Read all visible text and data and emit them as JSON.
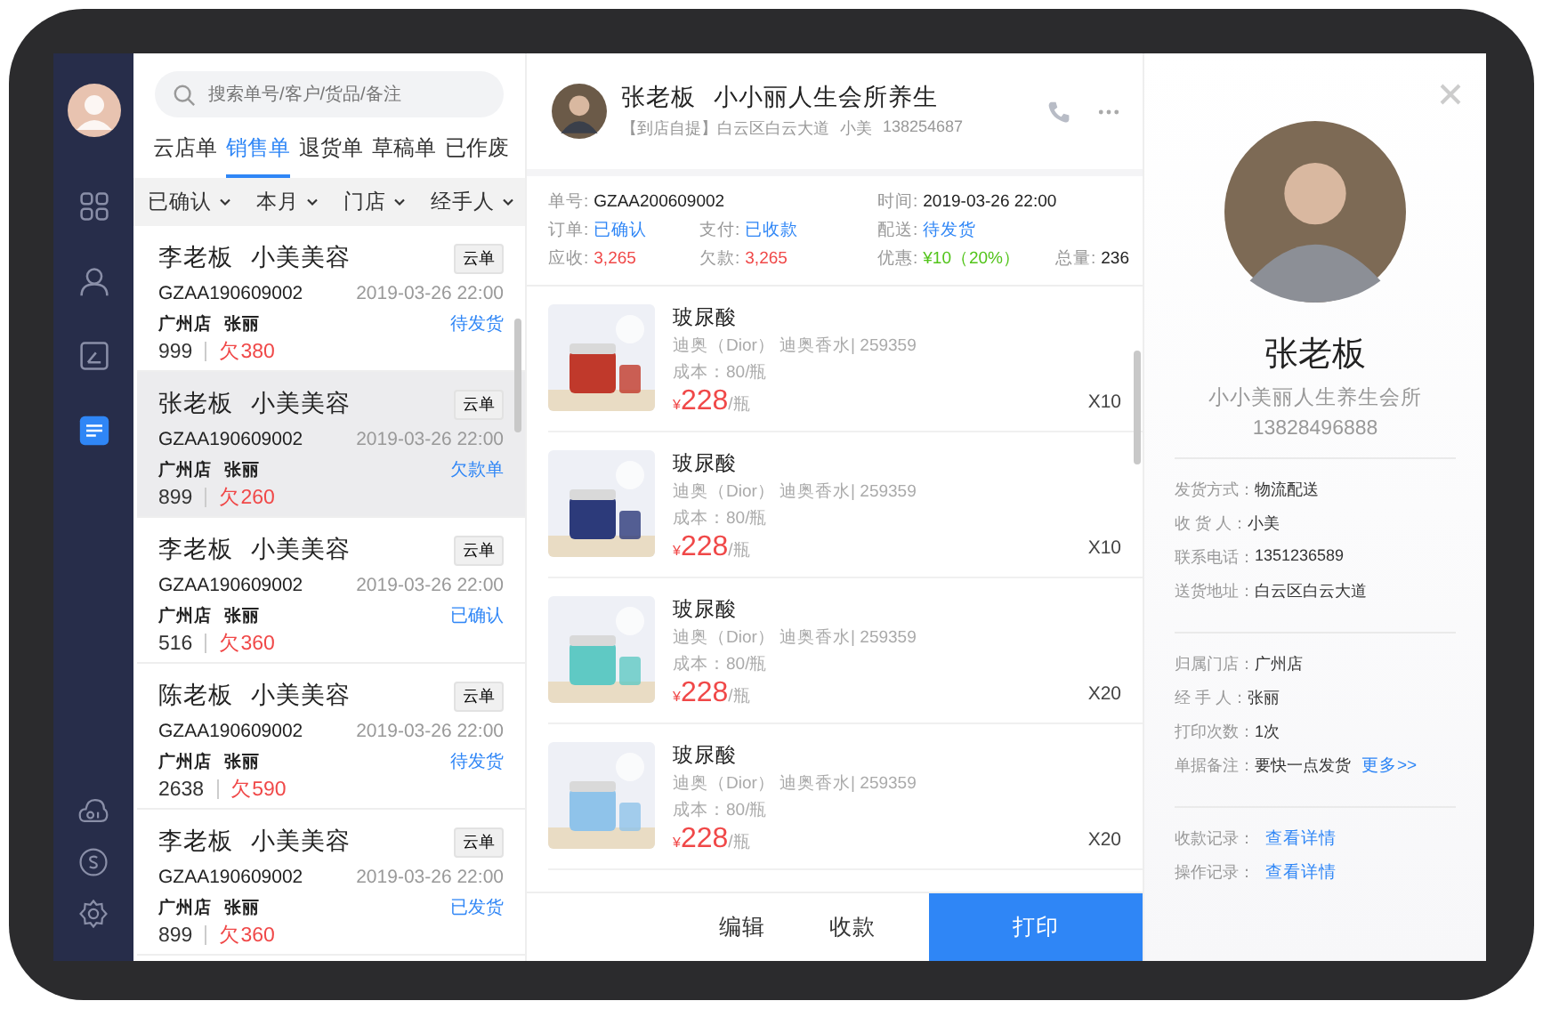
{
  "sidebar": {
    "nav": [
      {
        "kind": "grid",
        "selected": false
      },
      {
        "kind": "user",
        "selected": false
      },
      {
        "kind": "report",
        "selected": false
      },
      {
        "kind": "orders",
        "selected": true
      }
    ],
    "bottom": [
      {
        "kind": "ai"
      },
      {
        "kind": "coin"
      },
      {
        "kind": "gear"
      }
    ]
  },
  "order_list": {
    "search": {
      "placeholder": "搜索单号/客户/货品/备注"
    },
    "tabs": [
      {
        "label": "云店单",
        "selected": false
      },
      {
        "label": "销售单",
        "selected": true
      },
      {
        "label": "退货单",
        "selected": false
      },
      {
        "label": "草稿单",
        "selected": false
      },
      {
        "label": "已作废",
        "selected": false
      }
    ],
    "filters": [
      "已确认",
      "本月",
      "门店",
      "经手人"
    ],
    "orders": [
      {
        "customer": "李老板",
        "shop": "小美美容",
        "tag": "云单",
        "code": "GZAA190609002",
        "time": "2019-03-26 22:00",
        "store": "广州店",
        "handler": "张丽",
        "amount": "999",
        "debt": "欠380",
        "status": "待发货",
        "selected": false
      },
      {
        "customer": "张老板",
        "shop": "小美美容",
        "tag": "云单",
        "code": "GZAA190609002",
        "time": "2019-03-26 22:00",
        "store": "广州店",
        "handler": "张丽",
        "amount": "899",
        "debt": "欠260",
        "status": "欠款单",
        "selected": true
      },
      {
        "customer": "李老板",
        "shop": "小美美容",
        "tag": "云单",
        "code": "GZAA190609002",
        "time": "2019-03-26 22:00",
        "store": "广州店",
        "handler": "张丽",
        "amount": "516",
        "debt": "欠360",
        "status": "已确认",
        "selected": false
      },
      {
        "customer": "陈老板",
        "shop": "小美美容",
        "tag": "云单",
        "code": "GZAA190609002",
        "time": "2019-03-26 22:00",
        "store": "广州店",
        "handler": "张丽",
        "amount": "2638",
        "debt": "欠590",
        "status": "待发货",
        "selected": false
      },
      {
        "customer": "李老板",
        "shop": "小美美容",
        "tag": "云单",
        "code": "GZAA190609002",
        "time": "2019-03-26 22:00",
        "store": "广州店",
        "handler": "张丽",
        "amount": "899",
        "debt": "欠360",
        "status": "已发货",
        "selected": false
      }
    ]
  },
  "order_detail": {
    "customer": "张老板",
    "shop": "小小丽人生会所养生",
    "pickup": "【到店自提】白云区白云大道",
    "contact": "小美",
    "phone": "138254687",
    "fields": [
      {
        "label": "单号:",
        "value": "GZAA200609002",
        "kind": "plain"
      },
      {
        "label": "时间:",
        "value": "2019-03-26 22:00",
        "kind": "plain"
      },
      {
        "label": "订单:",
        "value": "已确认",
        "kind": "status"
      },
      {
        "label": "支付:",
        "value": "已收款",
        "kind": "status"
      },
      {
        "label": "配送:",
        "value": "待发货",
        "kind": "status"
      },
      {
        "label": "应收:",
        "value": "3,265",
        "kind": "money"
      },
      {
        "label": "欠款:",
        "value": "3,265",
        "kind": "money"
      },
      {
        "label": "优惠:",
        "value": "¥10（20%）",
        "kind": "discount"
      },
      {
        "label": "总量:",
        "value": "236",
        "kind": "plain"
      }
    ],
    "products": [
      {
        "name": "玻尿酸",
        "brand": "迪奥（Dior） 迪奥香水| 259359",
        "cost": "成本：80/瓶",
        "currency": "¥",
        "price": "228",
        "unit": "/瓶",
        "qty": "X10"
      },
      {
        "name": "玻尿酸",
        "brand": "迪奥（Dior） 迪奥香水| 259359",
        "cost": "成本：80/瓶",
        "currency": "¥",
        "price": "228",
        "unit": "/瓶",
        "qty": "X10"
      },
      {
        "name": "玻尿酸",
        "brand": "迪奥（Dior） 迪奥香水| 259359",
        "cost": "成本：80/瓶",
        "currency": "¥",
        "price": "228",
        "unit": "/瓶",
        "qty": "X20"
      },
      {
        "name": "玻尿酸",
        "brand": "迪奥（Dior） 迪奥香水| 259359",
        "cost": "成本：80/瓶",
        "currency": "¥",
        "price": "228",
        "unit": "/瓶",
        "qty": "X20"
      }
    ],
    "actions": [
      {
        "label": "编辑",
        "kind": "plain"
      },
      {
        "label": "收款",
        "kind": "plain"
      },
      {
        "label": "打印",
        "kind": "primary"
      }
    ]
  },
  "customer_panel": {
    "name": "张老板",
    "shop": "小小美丽人生养生会所",
    "phone": "13828496888",
    "groups": [
      [
        {
          "label": "发货方式：",
          "value": "物流配送"
        },
        {
          "label": "收 货 人：",
          "value": "小美"
        },
        {
          "label": "联系电话：",
          "value": "1351236589"
        },
        {
          "label": "送货地址：",
          "value": "白云区白云大道"
        }
      ],
      [
        {
          "label": "归属门店：",
          "value": "广州店"
        },
        {
          "label": "经 手 人：",
          "value": "张丽"
        },
        {
          "label": "打印次数：",
          "value": "1次"
        },
        {
          "label": "单据备注：",
          "value": "要快一点发货",
          "link": "更多>>"
        }
      ],
      [
        {
          "label": "收款记录：",
          "link": "查看详情"
        },
        {
          "label": "操作记录：",
          "link": "查看详情"
        }
      ]
    ]
  }
}
